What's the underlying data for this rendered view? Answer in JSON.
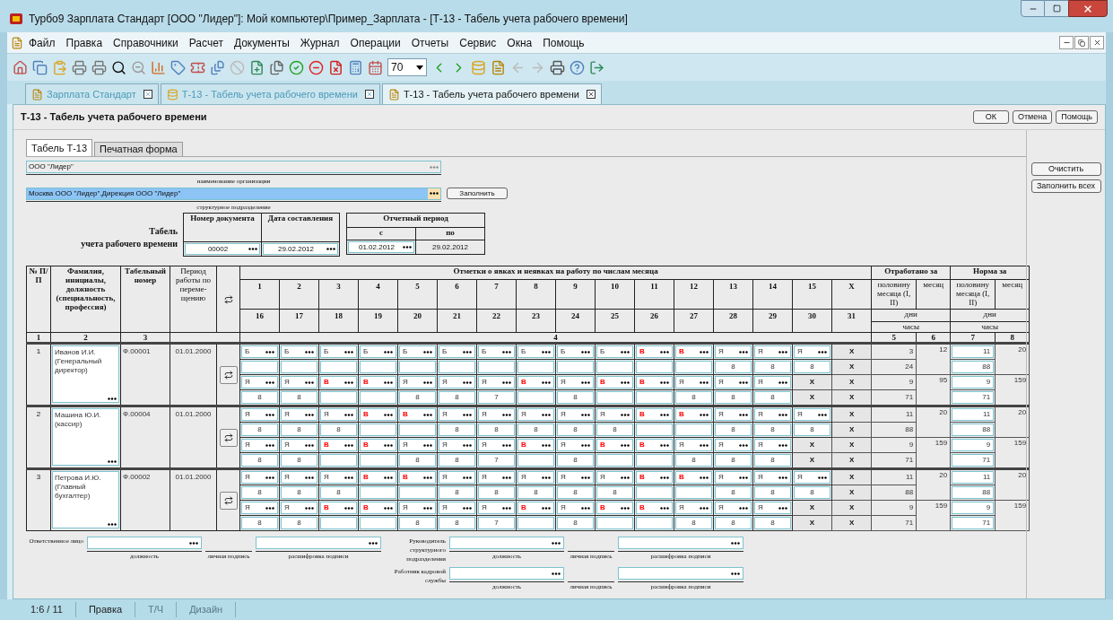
{
  "window": {
    "title": "Турбо9 Зарплата Стандарт [ООО \"Лидер\"]: Мой компьютер\\Пример_Зарплата - [Т-13 - Табель учета рабочего времени]"
  },
  "menu": [
    "Файл",
    "Правка",
    "Справочники",
    "Расчет",
    "Документы",
    "Журнал",
    "Операции",
    "Отчеты",
    "Сервис",
    "Окна",
    "Помощь"
  ],
  "toolbar": {
    "zoom": "70"
  },
  "doc_tabs": [
    {
      "label": "Зарплата Стандарт",
      "selected": false
    },
    {
      "label": "Т-13 - Табель учета рабочего времени",
      "selected": false
    },
    {
      "label": "Т-13 - Табель учета рабочего времени",
      "selected": true
    }
  ],
  "form": {
    "title": "Т-13 - Табель учета рабочего времени",
    "buttons": [
      "ОК",
      "Отмена",
      "Помощь"
    ]
  },
  "inner_tabs": [
    {
      "label": "Табель Т-13",
      "selected": true
    },
    {
      "label": "Печатная форма",
      "selected": false
    }
  ],
  "organization": {
    "value": "ООО \"Лидер\"",
    "caption": "наименование организации"
  },
  "subdivision": {
    "value": "Москва ООО \"Лидер\".Дирекция ООО \"Лидер\"",
    "caption": "структурное подразделение",
    "fill_button": "Заполнить"
  },
  "heading": [
    "Табель",
    "учета рабочего времени"
  ],
  "document": {
    "number_label": "Номер документа",
    "number": "00002",
    "date_label": "Дата составления",
    "date": "29.02.2012"
  },
  "period": {
    "label": "Отчетный период",
    "from_label": "с",
    "to_label": "по",
    "from": "01.02.2012",
    "to": "29.02.2012"
  },
  "side_buttons": [
    "Очистить",
    "Заполнить всех"
  ],
  "table": {
    "col_no": "№ П/П",
    "col_name": "Фамилия, инициалы, должность (специальность, профессия)",
    "col_tab": "Табельный номер",
    "col_period": "Период работы по переме-щению",
    "marks": "Отметки о явках и неявках на работу по числам месяца",
    "days_first": [
      "1",
      "2",
      "3",
      "4",
      "5",
      "6",
      "7",
      "8",
      "9",
      "10",
      "11",
      "12",
      "13",
      "14",
      "15",
      "X"
    ],
    "days_second": [
      "16",
      "17",
      "18",
      "19",
      "20",
      "21",
      "22",
      "23",
      "24",
      "25",
      "26",
      "27",
      "28",
      "29",
      "30",
      "31"
    ],
    "worked": "Отработано за",
    "norm": "Норма за",
    "half": [
      "половину месяца (I, II)",
      "половину месяца (I, II)"
    ],
    "month": [
      "месяц",
      "месяц"
    ],
    "days": [
      "дни",
      "дни"
    ],
    "hours": [
      "часы",
      "часы"
    ],
    "numbers": [
      "1",
      "2",
      "3",
      "4",
      "5",
      "6",
      "7",
      "8"
    ]
  },
  "employees": [
    {
      "number": "1",
      "name": "Иванов И.И. (Генеральный директор)",
      "tab_no": "Ф.00001",
      "period": "01.01.2000",
      "halves": [
        {
          "codes": [
            {
              "code": "Б",
              "weekend": false
            },
            {
              "code": "Б",
              "weekend": false
            },
            {
              "code": "Б",
              "weekend": false
            },
            {
              "code": "Б",
              "weekend": false
            },
            {
              "code": "Б",
              "weekend": false
            },
            {
              "code": "Б",
              "weekend": false
            },
            {
              "code": "Б",
              "weekend": false
            },
            {
              "code": "Б",
              "weekend": false
            },
            {
              "code": "Б",
              "weekend": false
            },
            {
              "code": "Б",
              "weekend": false
            },
            {
              "code": "В",
              "weekend": true
            },
            {
              "code": "В",
              "weekend": true
            },
            {
              "code": "Я",
              "weekend": false
            },
            {
              "code": "Я",
              "weekend": false
            },
            {
              "code": "Я",
              "weekend": false
            }
          ],
          "codes_fixed": [
            "X"
          ],
          "hours": [
            {
              "kind": "blank"
            },
            {
              "kind": "blank"
            },
            {
              "kind": "blank"
            },
            {
              "kind": "blank"
            },
            {
              "kind": "blank"
            },
            {
              "kind": "blank"
            },
            {
              "kind": "blank"
            },
            {
              "kind": "blank"
            },
            {
              "kind": "blank"
            },
            {
              "kind": "blank"
            },
            {
              "kind": "blank"
            },
            {
              "kind": "blank"
            },
            {
              "kind": "number",
              "value": "8"
            },
            {
              "kind": "number",
              "value": "8"
            },
            {
              "kind": "number",
              "value": "8"
            }
          ],
          "hours_fixed": [
            "X"
          ],
          "worked_days": "3",
          "worked_hours": "24",
          "worked_month": "12",
          "norm_days": "11",
          "norm_hours": "88",
          "norm_month": "20"
        },
        {
          "codes": [
            {
              "code": "Я",
              "weekend": false
            },
            {
              "code": "Я",
              "weekend": false
            },
            {
              "code": "В",
              "weekend": true
            },
            {
              "code": "В",
              "weekend": true
            },
            {
              "code": "Я",
              "weekend": false
            },
            {
              "code": "Я",
              "weekend": false
            },
            {
              "code": "Я",
              "weekend": false
            },
            {
              "code": "В",
              "weekend": true
            },
            {
              "code": "Я",
              "weekend": false
            },
            {
              "code": "В",
              "weekend": true
            },
            {
              "code": "В",
              "weekend": true
            },
            {
              "code": "Я",
              "weekend": false
            },
            {
              "code": "Я",
              "weekend": false
            },
            {
              "code": "Я",
              "weekend": false
            }
          ],
          "codes_fixed": [
            "X",
            "X"
          ],
          "hours": [
            {
              "kind": "number",
              "value": "8"
            },
            {
              "kind": "number",
              "value": "8"
            },
            {
              "kind": "blank"
            },
            {
              "kind": "blank"
            },
            {
              "kind": "number",
              "value": "8"
            },
            {
              "kind": "number",
              "value": "8"
            },
            {
              "kind": "number",
              "value": "7"
            },
            {
              "kind": "blank"
            },
            {
              "kind": "number",
              "value": "8"
            },
            {
              "kind": "blank"
            },
            {
              "kind": "blank"
            },
            {
              "kind": "number",
              "value": "8"
            },
            {
              "kind": "number",
              "value": "8"
            },
            {
              "kind": "number",
              "value": "8"
            }
          ],
          "hours_fixed": [
            "X",
            "X"
          ],
          "worked_days": "9",
          "worked_hours": "71",
          "worked_month": "95",
          "norm_days": "9",
          "norm_hours": "71",
          "norm_month": "159"
        }
      ]
    },
    {
      "number": "2",
      "name": "Машина Ю.И. (кассир)",
      "tab_no": "Ф.00004",
      "period": "01.01.2000",
      "halves": [
        {
          "codes": [
            {
              "code": "Я",
              "weekend": false
            },
            {
              "code": "Я",
              "weekend": false
            },
            {
              "code": "Я",
              "weekend": false
            },
            {
              "code": "В",
              "weekend": true
            },
            {
              "code": "В",
              "weekend": true
            },
            {
              "code": "Я",
              "weekend": false
            },
            {
              "code": "Я",
              "weekend": false
            },
            {
              "code": "Я",
              "weekend": false
            },
            {
              "code": "Я",
              "weekend": false
            },
            {
              "code": "Я",
              "weekend": false
            },
            {
              "code": "В",
              "weekend": true
            },
            {
              "code": "В",
              "weekend": true
            },
            {
              "code": "Я",
              "weekend": false
            },
            {
              "code": "Я",
              "weekend": false
            },
            {
              "code": "Я",
              "weekend": false
            }
          ],
          "codes_fixed": [
            "X"
          ],
          "hours": [
            {
              "kind": "number",
              "value": "8"
            },
            {
              "kind": "number",
              "value": "8"
            },
            {
              "kind": "number",
              "value": "8"
            },
            {
              "kind": "blank"
            },
            {
              "kind": "blank"
            },
            {
              "kind": "number",
              "value": "8"
            },
            {
              "kind": "number",
              "value": "8"
            },
            {
              "kind": "number",
              "value": "8"
            },
            {
              "kind": "number",
              "value": "8"
            },
            {
              "kind": "number",
              "value": "8"
            },
            {
              "kind": "blank"
            },
            {
              "kind": "blank"
            },
            {
              "kind": "number",
              "value": "8"
            },
            {
              "kind": "number",
              "value": "8"
            },
            {
              "kind": "number",
              "value": "8"
            }
          ],
          "hours_fixed": [
            "X"
          ],
          "worked_days": "11",
          "worked_hours": "88",
          "worked_month": "20",
          "norm_days": "11",
          "norm_hours": "88",
          "norm_month": "20"
        },
        {
          "codes": [
            {
              "code": "Я",
              "weekend": false
            },
            {
              "code": "Я",
              "weekend": false
            },
            {
              "code": "В",
              "weekend": true
            },
            {
              "code": "В",
              "weekend": true
            },
            {
              "code": "Я",
              "weekend": false
            },
            {
              "code": "Я",
              "weekend": false
            },
            {
              "code": "Я",
              "weekend": false
            },
            {
              "code": "В",
              "weekend": true
            },
            {
              "code": "Я",
              "weekend": false
            },
            {
              "code": "В",
              "weekend": true
            },
            {
              "code": "В",
              "weekend": true
            },
            {
              "code": "Я",
              "weekend": false
            },
            {
              "code": "Я",
              "weekend": false
            },
            {
              "code": "Я",
              "weekend": false
            }
          ],
          "codes_fixed": [
            "X",
            "X"
          ],
          "hours": [
            {
              "kind": "number",
              "value": "8"
            },
            {
              "kind": "number",
              "value": "8"
            },
            {
              "kind": "blank"
            },
            {
              "kind": "blank"
            },
            {
              "kind": "number",
              "value": "8"
            },
            {
              "kind": "number",
              "value": "8"
            },
            {
              "kind": "number",
              "value": "7"
            },
            {
              "kind": "blank"
            },
            {
              "kind": "number",
              "value": "8"
            },
            {
              "kind": "blank"
            },
            {
              "kind": "blank"
            },
            {
              "kind": "number",
              "value": "8"
            },
            {
              "kind": "number",
              "value": "8"
            },
            {
              "kind": "number",
              "value": "8"
            }
          ],
          "hours_fixed": [
            "X",
            "X"
          ],
          "worked_days": "9",
          "worked_hours": "71",
          "worked_month": "159",
          "norm_days": "9",
          "norm_hours": "71",
          "norm_month": "159"
        }
      ]
    },
    {
      "number": "3",
      "name": "Петрова И.Ю. (Главный бухгалтер)",
      "tab_no": "Ф.00002",
      "period": "01.01.2000",
      "halves": [
        {
          "codes": [
            {
              "code": "Я",
              "weekend": false
            },
            {
              "code": "Я",
              "weekend": false
            },
            {
              "code": "Я",
              "weekend": false
            },
            {
              "code": "В",
              "weekend": true
            },
            {
              "code": "В",
              "weekend": true
            },
            {
              "code": "Я",
              "weekend": false
            },
            {
              "code": "Я",
              "weekend": false
            },
            {
              "code": "Я",
              "weekend": false
            },
            {
              "code": "Я",
              "weekend": false
            },
            {
              "code": "Я",
              "weekend": false
            },
            {
              "code": "В",
              "weekend": true
            },
            {
              "code": "В",
              "weekend": true
            },
            {
              "code": "Я",
              "weekend": false
            },
            {
              "code": "Я",
              "weekend": false
            },
            {
              "code": "Я",
              "weekend": false
            }
          ],
          "codes_fixed": [
            "X"
          ],
          "hours": [
            {
              "kind": "number",
              "value": "8"
            },
            {
              "kind": "number",
              "value": "8"
            },
            {
              "kind": "number",
              "value": "8"
            },
            {
              "kind": "blank"
            },
            {
              "kind": "blank"
            },
            {
              "kind": "number",
              "value": "8"
            },
            {
              "kind": "number",
              "value": "8"
            },
            {
              "kind": "number",
              "value": "8"
            },
            {
              "kind": "number",
              "value": "8"
            },
            {
              "kind": "number",
              "value": "8"
            },
            {
              "kind": "blank"
            },
            {
              "kind": "blank"
            },
            {
              "kind": "number",
              "value": "8"
            },
            {
              "kind": "number",
              "value": "8"
            },
            {
              "kind": "number",
              "value": "8"
            }
          ],
          "hours_fixed": [
            "X"
          ],
          "worked_days": "11",
          "worked_hours": "88",
          "worked_month": "20",
          "norm_days": "11",
          "norm_hours": "88",
          "norm_month": "20"
        },
        {
          "codes": [
            {
              "code": "Я",
              "weekend": false
            },
            {
              "code": "Я",
              "weekend": false
            },
            {
              "code": "В",
              "weekend": true
            },
            {
              "code": "В",
              "weekend": true
            },
            {
              "code": "Я",
              "weekend": false
            },
            {
              "code": "Я",
              "weekend": false
            },
            {
              "code": "Я",
              "weekend": false
            },
            {
              "code": "В",
              "weekend": true
            },
            {
              "code": "Я",
              "weekend": false
            },
            {
              "code": "В",
              "weekend": true
            },
            {
              "code": "В",
              "weekend": true
            },
            {
              "code": "Я",
              "weekend": false
            },
            {
              "code": "Я",
              "weekend": false
            },
            {
              "code": "Я",
              "weekend": false
            }
          ],
          "codes_fixed": [
            "X",
            "X"
          ],
          "hours": [
            {
              "kind": "number",
              "value": "8"
            },
            {
              "kind": "number",
              "value": "8"
            },
            {
              "kind": "blank"
            },
            {
              "kind": "blank"
            },
            {
              "kind": "number",
              "value": "8"
            },
            {
              "kind": "number",
              "value": "8"
            },
            {
              "kind": "number",
              "value": "7"
            },
            {
              "kind": "blank"
            },
            {
              "kind": "number",
              "value": "8"
            },
            {
              "kind": "blank"
            },
            {
              "kind": "blank"
            },
            {
              "kind": "number",
              "value": "8"
            },
            {
              "kind": "number",
              "value": "8"
            },
            {
              "kind": "number",
              "value": "8"
            }
          ],
          "hours_fixed": [
            "X",
            "X"
          ],
          "worked_days": "9",
          "worked_hours": "71",
          "worked_month": "159",
          "norm_days": "9",
          "norm_hours": "71",
          "norm_month": "159"
        }
      ]
    }
  ],
  "signatures": [
    {
      "label": "Ответственное лицо",
      "position_caption": "должность",
      "sign_caption": "личная подпись",
      "name_caption": "расшифровка подписи"
    },
    {
      "label": "Руководитель структурного подразделения",
      "position_caption": "должность",
      "sign_caption": "личная подпись",
      "name_caption": "расшифровка подписи"
    },
    {
      "label": "Работник кадровой службы",
      "position_caption": "должность",
      "sign_caption": "личная подпись",
      "name_caption": "расшифровка подписи"
    }
  ],
  "status_bar": [
    {
      "label": "1:6 / 11",
      "disabled": false
    },
    {
      "label": "Правка",
      "disabled": false
    },
    {
      "label": "Т/Ч",
      "disabled": true
    },
    {
      "label": "Дизайн",
      "disabled": true
    }
  ]
}
